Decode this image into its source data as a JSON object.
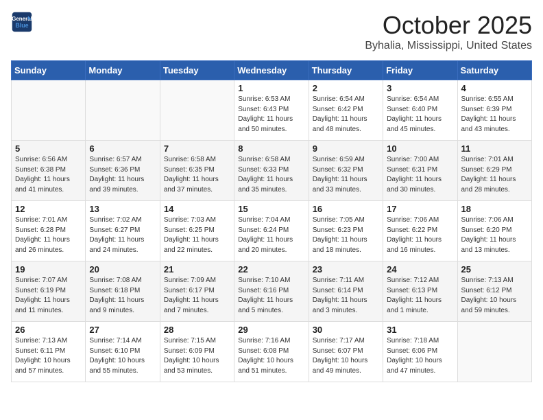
{
  "header": {
    "logo_line1": "General",
    "logo_line2": "Blue",
    "month": "October 2025",
    "location": "Byhalia, Mississippi, United States"
  },
  "weekdays": [
    "Sunday",
    "Monday",
    "Tuesday",
    "Wednesday",
    "Thursday",
    "Friday",
    "Saturday"
  ],
  "weeks": [
    [
      {
        "day": "",
        "info": ""
      },
      {
        "day": "",
        "info": ""
      },
      {
        "day": "",
        "info": ""
      },
      {
        "day": "1",
        "info": "Sunrise: 6:53 AM\nSunset: 6:43 PM\nDaylight: 11 hours\nand 50 minutes."
      },
      {
        "day": "2",
        "info": "Sunrise: 6:54 AM\nSunset: 6:42 PM\nDaylight: 11 hours\nand 48 minutes."
      },
      {
        "day": "3",
        "info": "Sunrise: 6:54 AM\nSunset: 6:40 PM\nDaylight: 11 hours\nand 45 minutes."
      },
      {
        "day": "4",
        "info": "Sunrise: 6:55 AM\nSunset: 6:39 PM\nDaylight: 11 hours\nand 43 minutes."
      }
    ],
    [
      {
        "day": "5",
        "info": "Sunrise: 6:56 AM\nSunset: 6:38 PM\nDaylight: 11 hours\nand 41 minutes."
      },
      {
        "day": "6",
        "info": "Sunrise: 6:57 AM\nSunset: 6:36 PM\nDaylight: 11 hours\nand 39 minutes."
      },
      {
        "day": "7",
        "info": "Sunrise: 6:58 AM\nSunset: 6:35 PM\nDaylight: 11 hours\nand 37 minutes."
      },
      {
        "day": "8",
        "info": "Sunrise: 6:58 AM\nSunset: 6:33 PM\nDaylight: 11 hours\nand 35 minutes."
      },
      {
        "day": "9",
        "info": "Sunrise: 6:59 AM\nSunset: 6:32 PM\nDaylight: 11 hours\nand 33 minutes."
      },
      {
        "day": "10",
        "info": "Sunrise: 7:00 AM\nSunset: 6:31 PM\nDaylight: 11 hours\nand 30 minutes."
      },
      {
        "day": "11",
        "info": "Sunrise: 7:01 AM\nSunset: 6:29 PM\nDaylight: 11 hours\nand 28 minutes."
      }
    ],
    [
      {
        "day": "12",
        "info": "Sunrise: 7:01 AM\nSunset: 6:28 PM\nDaylight: 11 hours\nand 26 minutes."
      },
      {
        "day": "13",
        "info": "Sunrise: 7:02 AM\nSunset: 6:27 PM\nDaylight: 11 hours\nand 24 minutes."
      },
      {
        "day": "14",
        "info": "Sunrise: 7:03 AM\nSunset: 6:25 PM\nDaylight: 11 hours\nand 22 minutes."
      },
      {
        "day": "15",
        "info": "Sunrise: 7:04 AM\nSunset: 6:24 PM\nDaylight: 11 hours\nand 20 minutes."
      },
      {
        "day": "16",
        "info": "Sunrise: 7:05 AM\nSunset: 6:23 PM\nDaylight: 11 hours\nand 18 minutes."
      },
      {
        "day": "17",
        "info": "Sunrise: 7:06 AM\nSunset: 6:22 PM\nDaylight: 11 hours\nand 16 minutes."
      },
      {
        "day": "18",
        "info": "Sunrise: 7:06 AM\nSunset: 6:20 PM\nDaylight: 11 hours\nand 13 minutes."
      }
    ],
    [
      {
        "day": "19",
        "info": "Sunrise: 7:07 AM\nSunset: 6:19 PM\nDaylight: 11 hours\nand 11 minutes."
      },
      {
        "day": "20",
        "info": "Sunrise: 7:08 AM\nSunset: 6:18 PM\nDaylight: 11 hours\nand 9 minutes."
      },
      {
        "day": "21",
        "info": "Sunrise: 7:09 AM\nSunset: 6:17 PM\nDaylight: 11 hours\nand 7 minutes."
      },
      {
        "day": "22",
        "info": "Sunrise: 7:10 AM\nSunset: 6:16 PM\nDaylight: 11 hours\nand 5 minutes."
      },
      {
        "day": "23",
        "info": "Sunrise: 7:11 AM\nSunset: 6:14 PM\nDaylight: 11 hours\nand 3 minutes."
      },
      {
        "day": "24",
        "info": "Sunrise: 7:12 AM\nSunset: 6:13 PM\nDaylight: 11 hours\nand 1 minute."
      },
      {
        "day": "25",
        "info": "Sunrise: 7:13 AM\nSunset: 6:12 PM\nDaylight: 10 hours\nand 59 minutes."
      }
    ],
    [
      {
        "day": "26",
        "info": "Sunrise: 7:13 AM\nSunset: 6:11 PM\nDaylight: 10 hours\nand 57 minutes."
      },
      {
        "day": "27",
        "info": "Sunrise: 7:14 AM\nSunset: 6:10 PM\nDaylight: 10 hours\nand 55 minutes."
      },
      {
        "day": "28",
        "info": "Sunrise: 7:15 AM\nSunset: 6:09 PM\nDaylight: 10 hours\nand 53 minutes."
      },
      {
        "day": "29",
        "info": "Sunrise: 7:16 AM\nSunset: 6:08 PM\nDaylight: 10 hours\nand 51 minutes."
      },
      {
        "day": "30",
        "info": "Sunrise: 7:17 AM\nSunset: 6:07 PM\nDaylight: 10 hours\nand 49 minutes."
      },
      {
        "day": "31",
        "info": "Sunrise: 7:18 AM\nSunset: 6:06 PM\nDaylight: 10 hours\nand 47 minutes."
      },
      {
        "day": "",
        "info": ""
      }
    ]
  ]
}
